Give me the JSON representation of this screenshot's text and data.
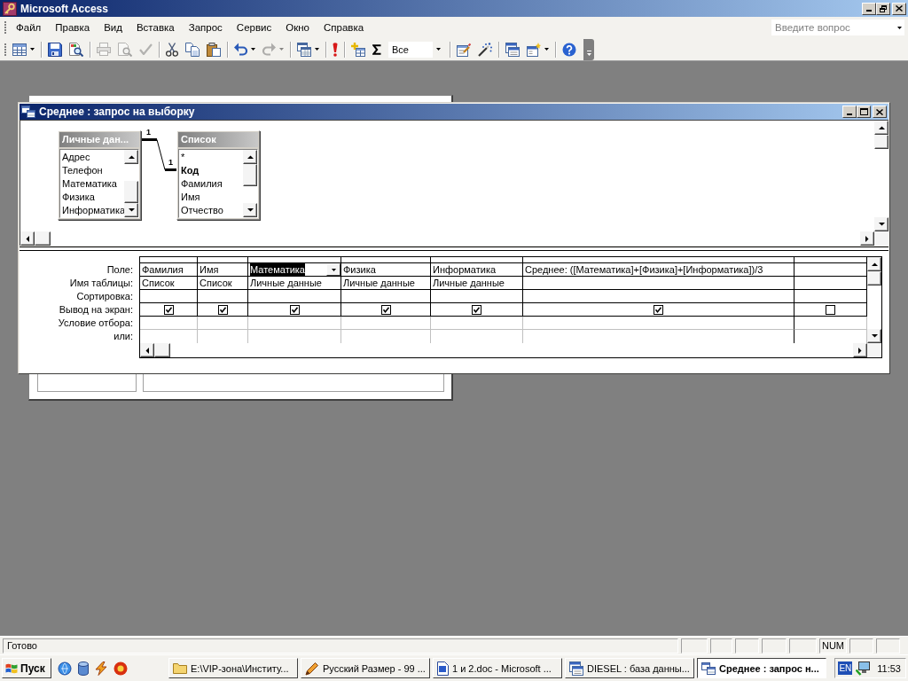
{
  "window": {
    "title": "Microsoft Access"
  },
  "menu": [
    {
      "label": "Файл"
    },
    {
      "label": "Правка"
    },
    {
      "label": "Вид"
    },
    {
      "label": "Вставка"
    },
    {
      "label": "Запрос"
    },
    {
      "label": "Сервис"
    },
    {
      "label": "Окно"
    },
    {
      "label": "Справка"
    }
  ],
  "help_search": {
    "placeholder": "Введите вопрос"
  },
  "toolbar": {
    "groups": [
      [
        {
          "kind": "view",
          "dropdown": true,
          "disabled": false
        }
      ],
      [
        {
          "kind": "save",
          "dropdown": false,
          "disabled": false
        },
        {
          "kind": "search",
          "dropdown": false,
          "disabled": false
        }
      ],
      [
        {
          "kind": "print",
          "dropdown": false,
          "disabled": true
        },
        {
          "kind": "preview",
          "dropdown": false,
          "disabled": true
        },
        {
          "kind": "spelling",
          "dropdown": false,
          "disabled": true
        }
      ],
      [
        {
          "kind": "cut",
          "dropdown": false,
          "disabled": false
        },
        {
          "kind": "copy",
          "dropdown": false,
          "disabled": false
        },
        {
          "kind": "paste",
          "dropdown": false,
          "disabled": false
        }
      ],
      [
        {
          "kind": "undo",
          "dropdown": true,
          "disabled": false
        },
        {
          "kind": "redo",
          "dropdown": true,
          "disabled": true
        }
      ],
      [
        {
          "kind": "querytype",
          "dropdown": true,
          "disabled": false
        }
      ],
      [
        {
          "kind": "run",
          "dropdown": false,
          "disabled": false
        }
      ],
      [
        {
          "kind": "addtable",
          "dropdown": false,
          "disabled": false
        },
        {
          "kind": "totals",
          "dropdown": false,
          "disabled": false
        },
        {
          "kind": "topvalues",
          "value": "Все",
          "dropdown": true,
          "disabled": false
        }
      ],
      [
        {
          "kind": "properties",
          "dropdown": false,
          "disabled": false
        },
        {
          "kind": "builder",
          "dropdown": false,
          "disabled": false
        }
      ],
      [
        {
          "kind": "dbwindow",
          "dropdown": false,
          "disabled": false
        },
        {
          "kind": "newobject",
          "dropdown": true,
          "disabled": false
        }
      ],
      [
        {
          "kind": "help",
          "dropdown": false,
          "disabled": false
        }
      ]
    ]
  },
  "query_window": {
    "title": "Среднее : запрос на выборку",
    "tables": [
      {
        "title": "Личные дан...",
        "fields": [
          {
            "name": "Адрес",
            "key": false
          },
          {
            "name": "Телефон",
            "key": false
          },
          {
            "name": "Математика",
            "key": false
          },
          {
            "name": "Физика",
            "key": false
          },
          {
            "name": "Информатика",
            "key": false
          }
        ]
      },
      {
        "title": "Список",
        "fields": [
          {
            "name": "*",
            "key": false
          },
          {
            "name": "Код",
            "key": true
          },
          {
            "name": "Фамилия",
            "key": false
          },
          {
            "name": "Имя",
            "key": false
          },
          {
            "name": "Отчество",
            "key": false
          }
        ]
      }
    ],
    "relationship": {
      "left_end": "1",
      "right_end": "1"
    },
    "grid": {
      "row_labels": [
        "Поле:",
        "Имя таблицы:",
        "Сортировка:",
        "Вывод на экран:",
        "Условие отбора:",
        "или:"
      ],
      "columns": [
        {
          "field": "Фамилия",
          "table": "Список",
          "show": true,
          "selected": false
        },
        {
          "field": "Имя",
          "table": "Список",
          "show": true,
          "selected": false
        },
        {
          "field": "Математика",
          "table": "Личные данные",
          "show": true,
          "selected": true
        },
        {
          "field": "Физика",
          "table": "Личные данные",
          "show": true,
          "selected": false
        },
        {
          "field": "Информатика",
          "table": "Личные данные",
          "show": true,
          "selected": false
        },
        {
          "field": "Среднее: ([Математика]+[Физика]+[Информатика])/3",
          "show": true,
          "selected": false
        },
        {
          "show": false,
          "selected": false
        }
      ]
    }
  },
  "status_bar": {
    "text": "Готово",
    "panels": [
      {
        "kind": "empty"
      },
      {
        "kind": "empty"
      },
      {
        "kind": "empty"
      },
      {
        "kind": "empty"
      },
      {
        "kind": "empty"
      },
      {
        "kind": "indicator",
        "label": "NUM"
      },
      {
        "kind": "empty"
      },
      {
        "kind": "empty"
      }
    ]
  },
  "taskbar": {
    "start_button": "Пуск",
    "quick_launch": [
      {
        "kind": "browser"
      },
      {
        "kind": "cylinder"
      },
      {
        "kind": "lightning"
      },
      {
        "kind": "ring"
      }
    ],
    "tasks": [
      {
        "kind": "folder",
        "label": "E:\\VIP-зона\\Институ...",
        "selected": false
      },
      {
        "kind": "media",
        "label": "Русский Размер - 99 ...",
        "selected": false
      },
      {
        "kind": "doc",
        "label": "1 и 2.doc - Microsoft ...",
        "selected": false
      },
      {
        "kind": "database",
        "label": "DIESEL : база данны...",
        "selected": false
      },
      {
        "kind": "query",
        "label": "Среднее : запрос н...",
        "selected": true
      }
    ],
    "tray": {
      "language": "EN",
      "time": "11:53"
    }
  }
}
